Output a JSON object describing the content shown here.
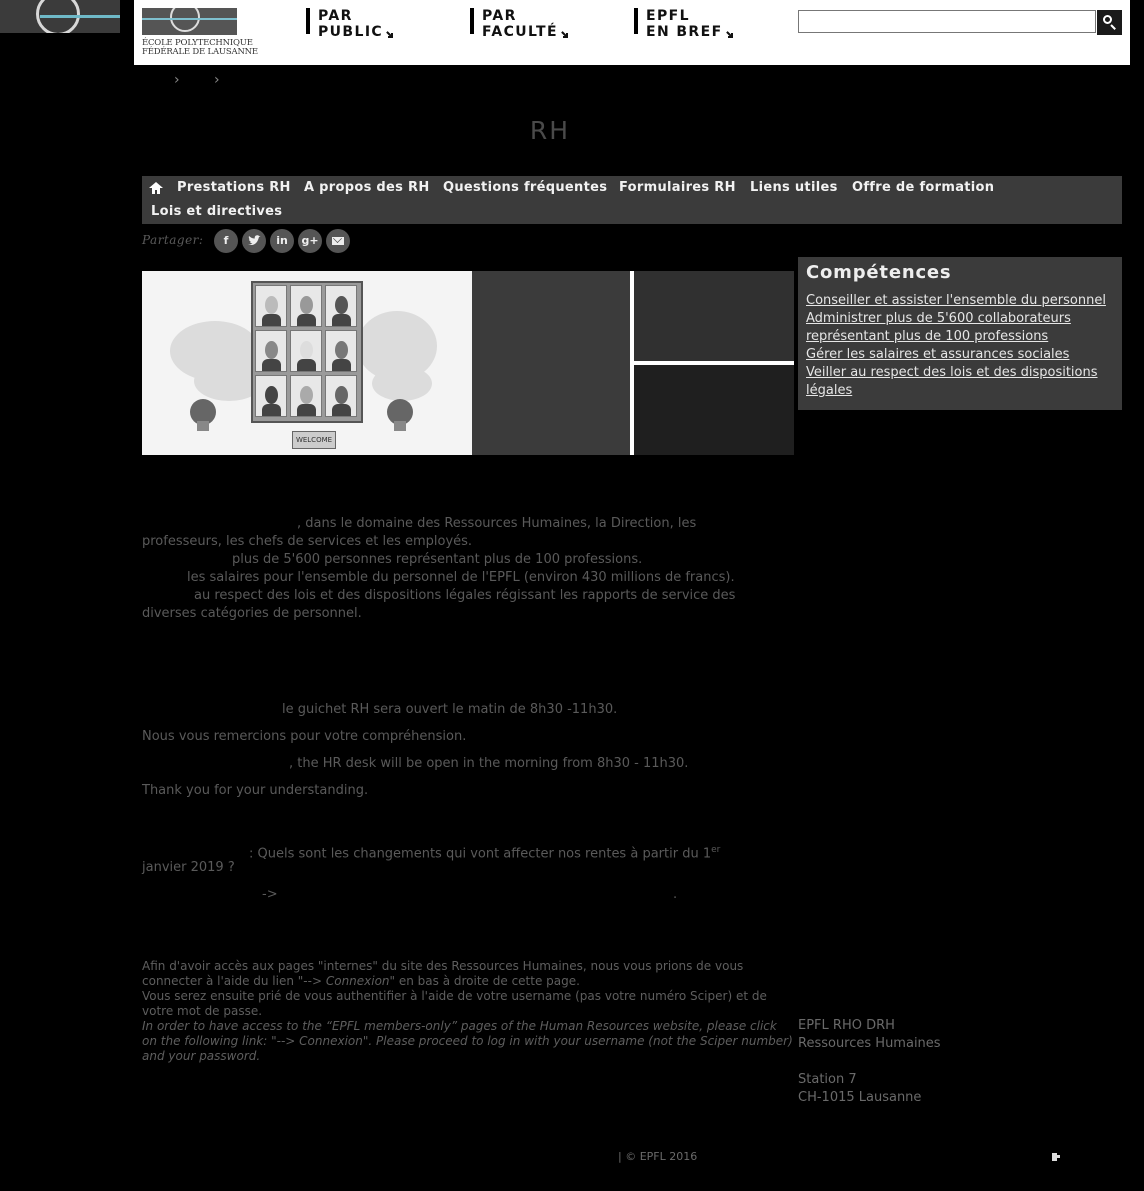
{
  "header": {
    "logo_line1": "ÉCOLE POLYTECHNIQUE",
    "logo_line2": "FÉDÉRALE DE LAUSANNE",
    "nav": [
      {
        "line1": "PAR",
        "line2": "PUBLIC"
      },
      {
        "line1": "PAR",
        "line2": "FACULTÉ"
      },
      {
        "line1": "EPFL",
        "line2": "EN BREF"
      }
    ],
    "search": {
      "value": "",
      "placeholder": ""
    }
  },
  "breadcrumb": {
    "separators": [
      "›",
      "›"
    ]
  },
  "page": {
    "title": "RH"
  },
  "section_nav": {
    "items": [
      "Prestations RH",
      "A propos des RH",
      "Questions fréquentes",
      "Formulaires RH",
      "Liens utiles",
      "Offre de formation",
      "Lois et directives"
    ]
  },
  "share": {
    "label": "Partager:",
    "facebook": "f",
    "linkedin": "in",
    "googleplus": "g+"
  },
  "hero": {
    "welcome": "WELCOME"
  },
  "competences": {
    "title": "Compétences",
    "links": [
      "Conseiller et assister l'ensemble du personnel",
      "Administrer plus de 5'600 collaborateurs",
      "représentant plus de 100 professions",
      "Gérer les salaires et assurances sociales",
      "Veiller au respect des lois et des dispositions",
      "légales"
    ]
  },
  "intro": {
    "l1": ", dans le domaine des Ressources Humaines, la Direction, les",
    "l2": "professeurs, les chefs de services et les employés.",
    "l3": "plus de 5'600 personnes représentant plus de 100 professions.",
    "l4": "les salaires pour l'ensemble du personnel de l'EPFL (environ 430 millions de francs).",
    "l5": "au respect des lois et des dispositions légales régissant les rapports de service des",
    "l6": "diverses catégories de personnel."
  },
  "notice": {
    "fr": "le guichet RH sera ouvert le matin de 8h30 -11h30.",
    "fr_thanks": "Nous vous remercions pour votre compréhension.",
    "en": ", the HR desk will be open in the morning from 8h30 - 11h30.",
    "en_thanks": "Thank you for your understanding."
  },
  "pension": {
    "q1": ": Quels sont les changements qui vont affecter nos rentes à partir du 1",
    "sup": "er",
    "q2": "janvier 2019 ?",
    "arrow": "->",
    "dot": "."
  },
  "access": {
    "fr1": "Afin d'avoir accès aux pages \"internes\" du site des Ressources Humaines, nous vous prions de vous",
    "fr2a": "connecter à l'aide du lien ",
    "fr2b": "\"--> ",
    "fr2c": "Connexion",
    "fr2d": "\" en bas à droite de cette page.",
    "fr3a": "Vous serez ensuite prié de vous authentifier à l'aide de votre ",
    "fr3_username": "username ",
    "fr3b": "(pas votre numéro Sciper) et de",
    "fr4_password": "votre mot de passe",
    "fr4b": ".",
    "en1": "In order to have access to the “EPFL members-only” pages of the Human Resources website, please click",
    "en2a": "on the following link: \"",
    "en2_link": "--> Connexion",
    "en2b": "\". Please proceed to log in with your ",
    "en2_username": "username ",
    "en2c": "(not the Sciper number)",
    "en3a": "and your ",
    "en3_password": "password",
    "en3b": "."
  },
  "contact": {
    "l1": "EPFL RHO DRH",
    "l2": "Ressources Humaines",
    "l3": "Station 7",
    "l4": "CH-1015 Lausanne"
  },
  "footer": {
    "copyright": "| © EPFL 2016"
  }
}
